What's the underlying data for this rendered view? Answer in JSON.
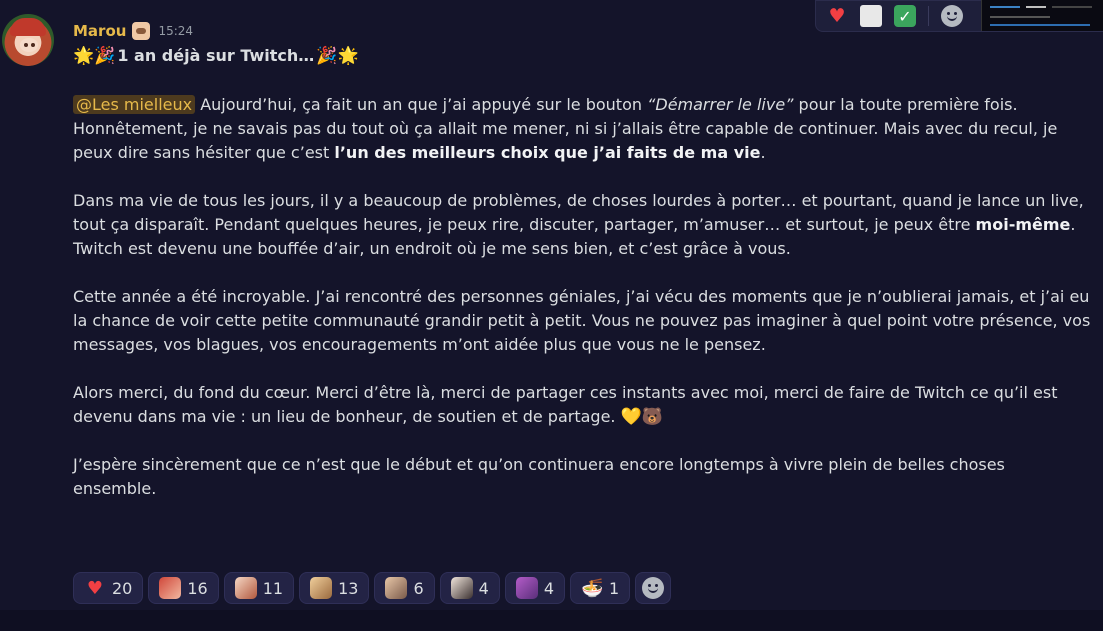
{
  "message": {
    "author": "Marou",
    "timestamp": "15:24",
    "title": {
      "emoji_left": "🌟🎉",
      "text": "1 an déjà sur Twitch…",
      "emoji_right": "🎉🌟"
    },
    "p1": {
      "mention": "@Les mielleux",
      "t1": " Aujourd’hui, ça fait un an que j’ai appuyé sur le bouton ",
      "italic": "“Démarrer le live”",
      "t2": " pour la toute première fois. Honnêtement, je ne savais pas du tout où ça allait me mener, ni si j’allais être capable de continuer. Mais avec du recul, je peux dire sans hésiter que c’est ",
      "bold": "l’un des meilleurs choix que j’ai faits de ma vie",
      "t3": "."
    },
    "p2": {
      "t1": "Dans ma vie de tous les jours, il y a beaucoup de problèmes, de choses lourdes à porter… et pourtant, quand je lance un live, tout ça disparaît. Pendant quelques heures, je peux rire, discuter, partager, m’amuser… et surtout, je peux être ",
      "bold": "moi-même",
      "t2": ". Twitch est devenu une bouffée d’air, un endroit où je me sens bien, et c’est grâce à vous."
    },
    "p3": "Cette année a été incroyable. J’ai rencontré des personnes géniales, j’ai vécu des moments que je n’oublierai jamais, et j’ai eu la chance de voir cette petite communauté grandir petit à petit. Vous ne pouvez pas imaginer à quel point votre présence, vos messages, vos blagues, vos encouragements m’ont aidée plus que vous ne le pensez.",
    "p4": {
      "text": "Alors merci, du fond du cœur. Merci d’être là, merci de partager ces instants avec moi, merci de faire de Twitch ce qu’il est devenu dans ma vie : un lieu de bonheur, de soutien et de partage.",
      "emoji": "💛🐻"
    },
    "p5": "J’espère sincèrement que ce n’est que le début et qu’on continuera encore longtemps à vivre plein de belles choses ensemble."
  },
  "reactions": [
    {
      "emoji": "❤️",
      "count": "20"
    },
    {
      "emoji": "custom-emote-redhair",
      "count": "16"
    },
    {
      "emoji": "custom-emote-chibi",
      "count": "11"
    },
    {
      "emoji": "custom-emote-bear",
      "count": "13"
    },
    {
      "emoji": "custom-emote-girl",
      "count": "6"
    },
    {
      "emoji": "custom-emote-hand",
      "count": "4"
    },
    {
      "emoji": "custom-emote-purple",
      "count": "4"
    },
    {
      "emoji": "🍜",
      "count": "1"
    }
  ],
  "toolbar": {
    "items": [
      "heart-reaction",
      "sticker-reaction",
      "check-reaction",
      "add-reaction"
    ]
  },
  "colors": {
    "background": "#14142a",
    "username": "#e6b94a",
    "mention_bg": "#4d3a1e",
    "reaction_bg": "#232345"
  }
}
